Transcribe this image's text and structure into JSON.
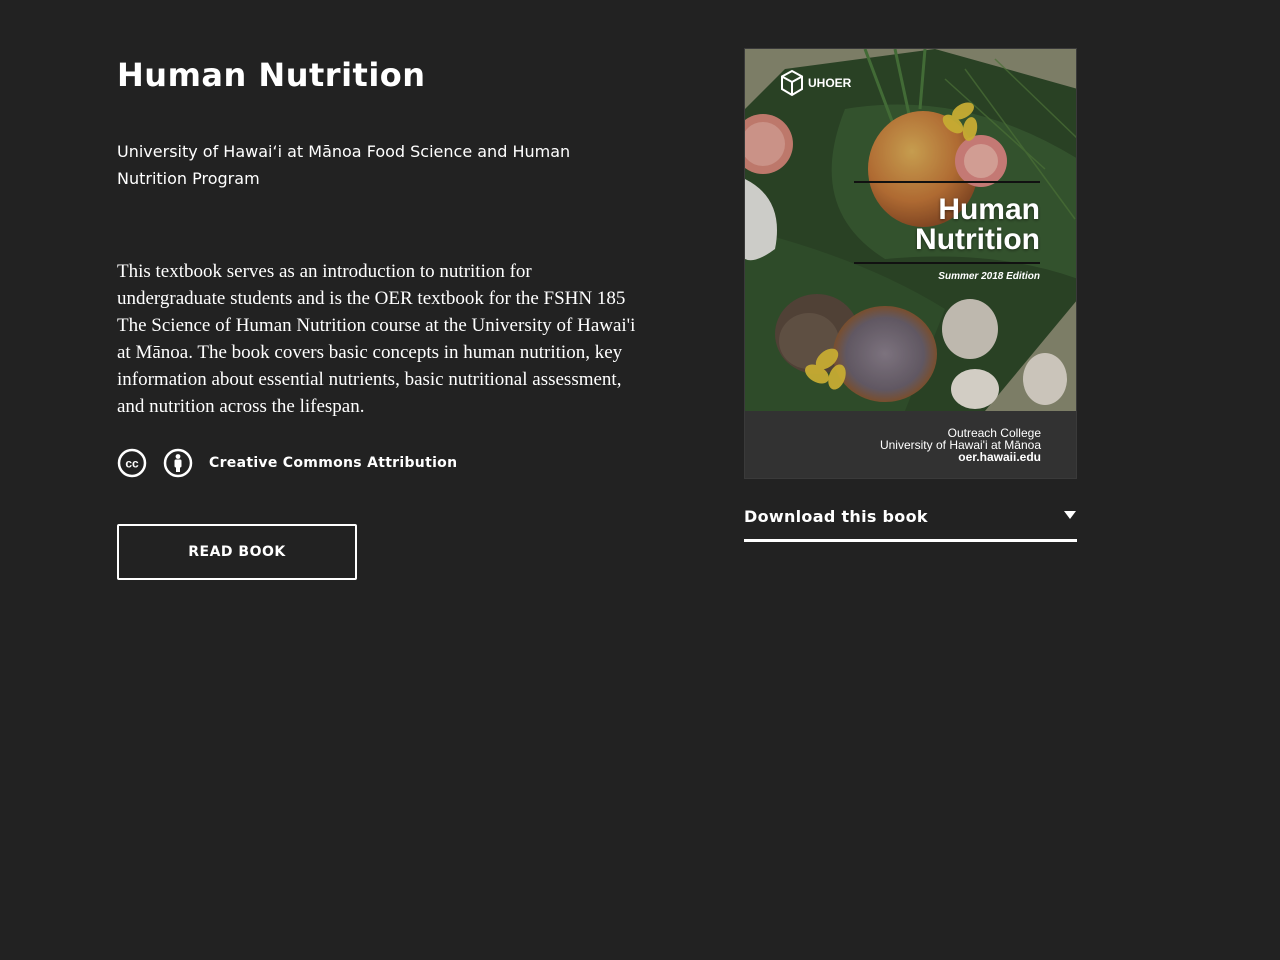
{
  "book": {
    "title": "Human Nutrition",
    "authors": "University of Hawai‘i at Mānoa Food Science and Human Nutrition Program",
    "description": "This textbook serves as an introduction to nutrition for undergraduate students and is the OER textbook for the FSHN 185 The Science of Human Nutrition course at the University of Hawai'i at Mānoa. The book covers basic concepts in human nutrition, key information about essential nutrients, basic nutritional assessment, and nutrition across the lifespan.",
    "license_label": "Creative Commons Attribution",
    "license_icons": [
      "cc-icon",
      "attribution-icon"
    ],
    "read_button": "READ BOOK"
  },
  "cover": {
    "brand": "UHOER",
    "title_line1": "Human",
    "title_line2": "Nutrition",
    "edition": "Summer 2018 Edition",
    "footer_line1": "Outreach College",
    "footer_line2": "University of Hawai'i at Mānoa",
    "footer_url": "oer.hawaii.edu"
  },
  "download": {
    "label": "Download this book"
  },
  "colors": {
    "background": "#222222",
    "text": "#ffffff",
    "cover_footer": "#323232"
  }
}
